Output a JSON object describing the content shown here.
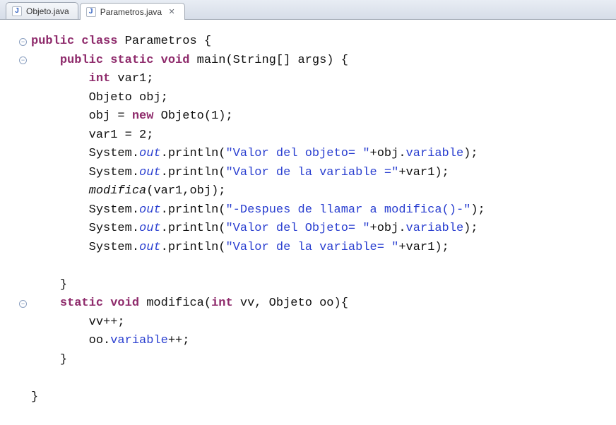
{
  "tabs": [
    {
      "label": "Objeto.java",
      "active": false,
      "closeable": false
    },
    {
      "label": "Parametros.java",
      "active": true,
      "closeable": true
    }
  ],
  "fold_glyph": "−",
  "code": {
    "class_decl_pre": "public class",
    "class_name": " Parametros {",
    "main_decl_pre": "public static void",
    "main_sig": " main(String[] args) {",
    "int_kw": "int",
    "var1_decl": " var1;",
    "obj_decl": "Objeto obj;",
    "obj_assign_pre": "obj = ",
    "new_kw": "new",
    "obj_assign_post": " Objeto(1);",
    "var1_assign": "var1 = 2;",
    "sys": "System.",
    "out": "out",
    "println": ".println(",
    "str1": "\"Valor del objeto= \"",
    "plus_obj_var": "+obj.",
    "variable_field": "variable",
    "close_stmt": ");",
    "str2": "\"Valor de la variable =\"",
    "plus_var1": "+var1);",
    "modifica_call_name": "modifica",
    "modifica_call_args": "(var1,obj);",
    "str3": "\"-Despues de llamar a modifica()-\"",
    "str4": "\"Valor del Objeto= \"",
    "str5": "\"Valor de la variable= \"",
    "close_brace": "}",
    "modifica_decl_pre": "static void",
    "modifica_sig": " modifica(",
    "int_kw2": "int",
    "modifica_sig_mid": " vv, Objeto oo){",
    "vv_inc": "vv++;",
    "oo_pre": "oo.",
    "oo_post": "++;"
  }
}
